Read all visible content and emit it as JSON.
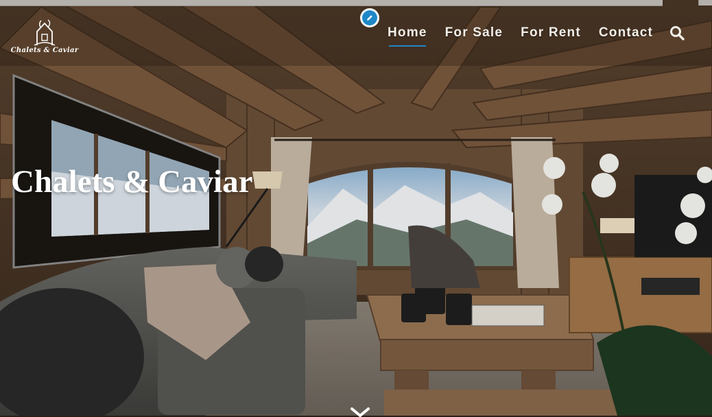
{
  "brand": {
    "logo_text": "Chalets & Caviar",
    "logo_icon": "chalet-logo-icon"
  },
  "nav": {
    "items": [
      {
        "label": "Home",
        "active": true
      },
      {
        "label": "For Sale",
        "active": false
      },
      {
        "label": "For Rent",
        "active": false
      },
      {
        "label": "Contact",
        "active": false
      }
    ],
    "search_icon": "search-icon"
  },
  "edit_icon": "pencil-icon",
  "hero": {
    "title": "Chalets & Caviar",
    "scroll_icon": "chevron-down-icon"
  },
  "colors": {
    "accent": "#1e87c8",
    "nav_text": "#f3efe9",
    "title_text": "#ffffff"
  }
}
